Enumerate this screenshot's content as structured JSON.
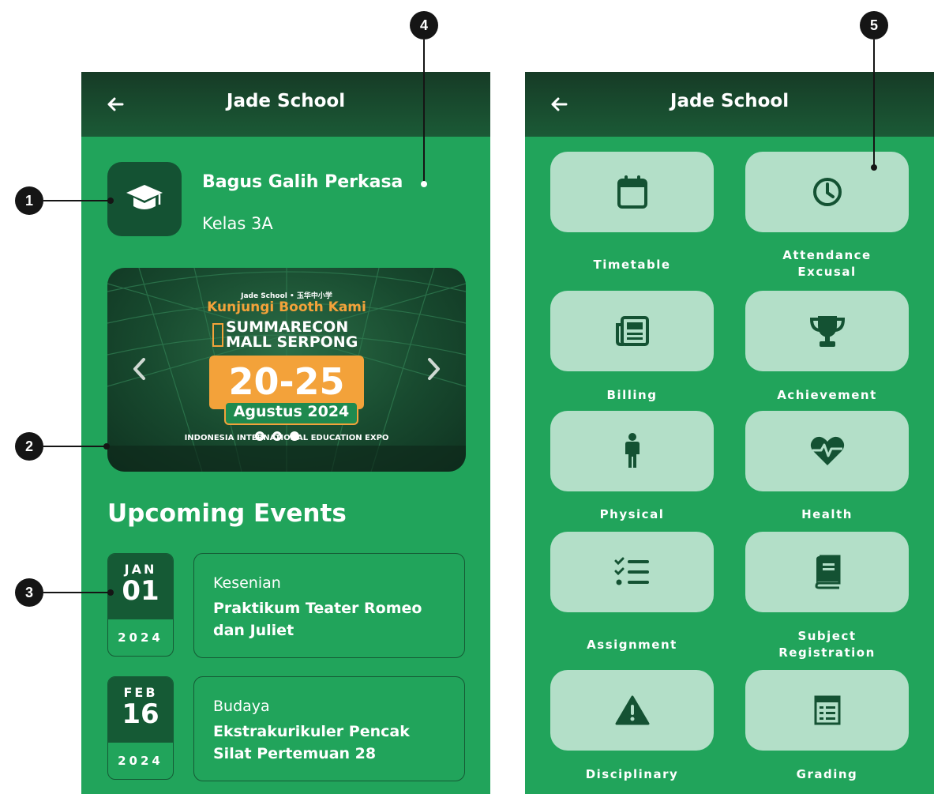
{
  "left_screen": {
    "app_title": "Jade School",
    "student": {
      "name": "Bagus Galih Perkasa",
      "class": "Kelas 3A"
    },
    "banner": {
      "top_text": "Jade School • 玉华中小学",
      "headline": "Kunjungi Booth Kami",
      "venue_line1": "SUMMARECON",
      "venue_line2": "MALL SERPONG",
      "dates": "20-25",
      "month": "Agustus 2024",
      "expo": "INDONESIA INTERNATIONAL EDUCATION EXPO",
      "slide_count": 3,
      "active_slide": 3
    },
    "section_title": "Upcoming Events",
    "events": [
      {
        "month": "JAN",
        "day": "01",
        "year": "2024",
        "category": "Kesenian",
        "title": "Praktikum Teater Romeo dan Juliet"
      },
      {
        "month": "FEB",
        "day": "16",
        "year": "2024",
        "category": "Budaya",
        "title": "Ekstrakurikuler Pencak Silat Pertemuan 28"
      }
    ]
  },
  "right_screen": {
    "app_title": "Jade School",
    "menu": [
      {
        "label": "Timetable",
        "icon": "calendar-icon"
      },
      {
        "label": "Attendance Excusal",
        "icon": "clock-icon"
      },
      {
        "label": "Billing",
        "icon": "newspaper-icon"
      },
      {
        "label": "Achievement",
        "icon": "trophy-icon"
      },
      {
        "label": "Physical",
        "icon": "person-icon"
      },
      {
        "label": "Health",
        "icon": "heart-pulse-icon"
      },
      {
        "label": "Assignment",
        "icon": "checklist-icon"
      },
      {
        "label": "Subject Registration",
        "icon": "book-icon"
      },
      {
        "label": "Disciplinary",
        "icon": "warning-icon"
      },
      {
        "label": "Grading",
        "icon": "report-icon"
      }
    ]
  },
  "annotations": [
    "1",
    "2",
    "3",
    "4",
    "5"
  ],
  "colors": {
    "screen_bg": "#21a45b",
    "appbar": "#163b26",
    "dark_green": "#145233",
    "tile_bg": "#b3dfc8",
    "banner_orange": "#f3a23a"
  }
}
